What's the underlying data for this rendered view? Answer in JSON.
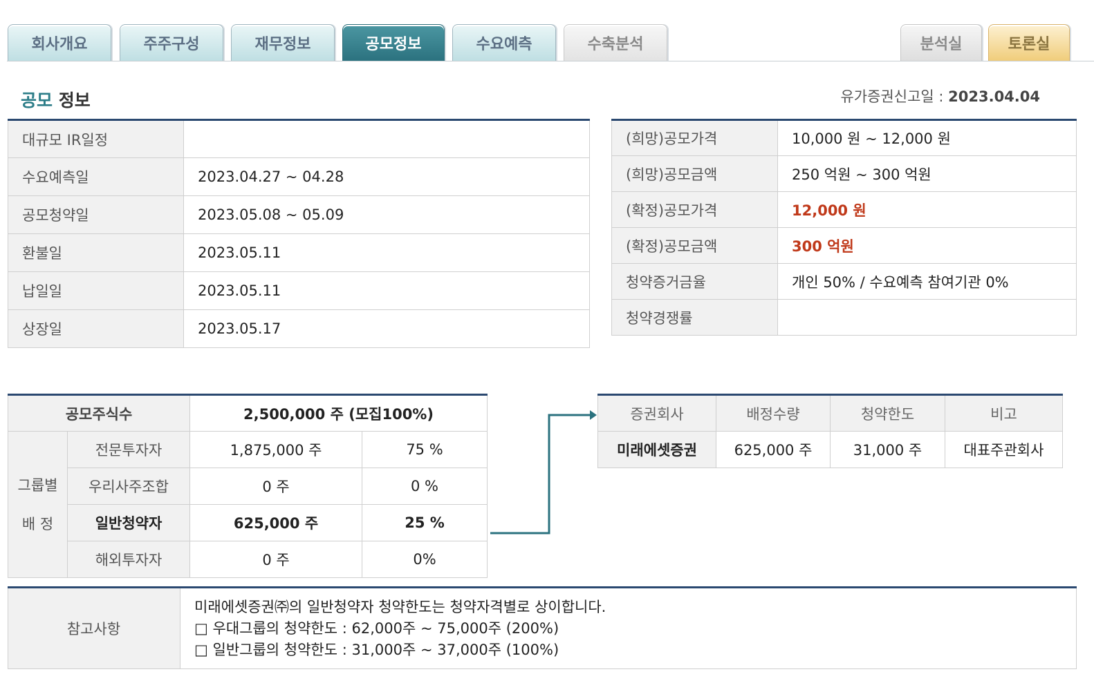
{
  "tabs": {
    "company": "회사개요",
    "shareholders": "주주구성",
    "financial": "재무정보",
    "offering": "공모정보",
    "demand": "수요예측",
    "yield": "수축분석",
    "analysis": "분석실",
    "discussion": "토론실"
  },
  "section": {
    "title_highlight": "공모",
    "title_rest": " 정보",
    "filing_label": "유가증권신고일 : ",
    "filing_date": "2023.04.04"
  },
  "schedule": [
    {
      "label": "대규모 IR일정",
      "value": ""
    },
    {
      "label": "수요예측일",
      "value": "2023.04.27 ~ 04.28"
    },
    {
      "label": "공모청약일",
      "value": "2023.05.08 ~ 05.09"
    },
    {
      "label": "환불일",
      "value": "2023.05.11"
    },
    {
      "label": "납일일",
      "value": "2023.05.11"
    },
    {
      "label": "상장일",
      "value": "2023.05.17"
    }
  ],
  "pricing": [
    {
      "label": "(희망)공모가격",
      "value": "10,000 원 ~ 12,000 원"
    },
    {
      "label": "(희망)공모금액",
      "value": "250 억원  ~ 300 억원"
    },
    {
      "label": "(확정)공모가격",
      "value": "12,000 원"
    },
    {
      "label": "(확정)공모금액",
      "value": "300 억원"
    },
    {
      "label": "청약증거금율",
      "value": "개인 50% / 수요예측 참여기관 0%"
    },
    {
      "label": "청약경쟁률",
      "value": ""
    }
  ],
  "allocation": {
    "total_label": "공모주식수",
    "total_value": "2,500,000 주 (모집100%)",
    "group_label_1": "그룹별",
    "group_label_2": "배 정",
    "rows": [
      {
        "name": "전문투자자",
        "shares": "1,875,000 주",
        "pct": "75 %"
      },
      {
        "name": "우리사주조합",
        "shares": "0 주",
        "pct": "0 %"
      },
      {
        "name": "일반청약자",
        "shares": "625,000 주",
        "pct": "25 %"
      },
      {
        "name": "해외투자자",
        "shares": "0 주",
        "pct": "0%"
      }
    ]
  },
  "broker": {
    "headers": [
      "증권회사",
      "배정수량",
      "청약한도",
      "비고"
    ],
    "row": {
      "name": "미래에셋증권",
      "alloc": "625,000 주",
      "limit": "31,000 주",
      "note": "대표주관회사"
    }
  },
  "notes": {
    "label": "참고사항",
    "lines": [
      "미래에셋증권㈜의 일반청약자 청약한도는 청약자격별로 상이합니다.",
      "□ 우대그룹의 청약한도 : 62,000주 ~ 75,000주 (200%)",
      "□ 일반그룹의 청약한도 : 31,000주 ~ 37,000주 (100%)"
    ]
  },
  "colors": {
    "accent_teal": "#2b727f",
    "table_top_border": "#2a4870",
    "highlight_red": "#c0391a",
    "arrow": "#2b727f"
  }
}
